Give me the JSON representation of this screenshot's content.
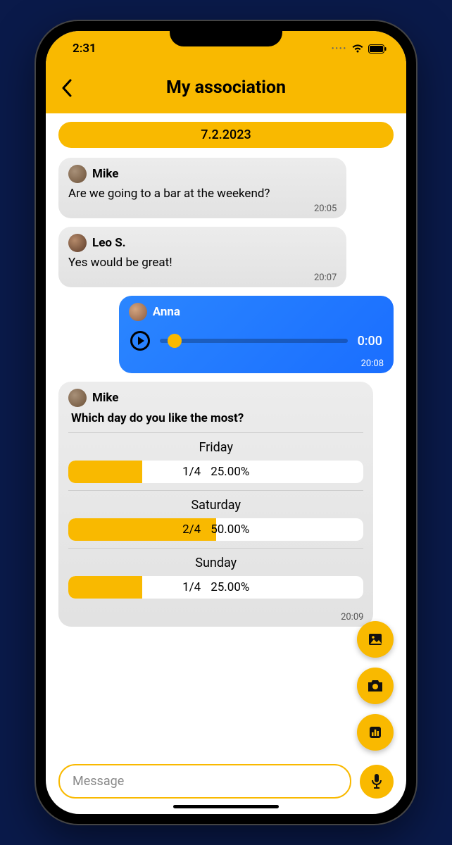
{
  "status": {
    "time": "2:31"
  },
  "header": {
    "title": "My association"
  },
  "date_label": "7.2.2023",
  "messages": {
    "m1": {
      "sender": "Mike",
      "text": "Are we going to a bar at the weekend?",
      "time": "20:05"
    },
    "m2": {
      "sender": "Leo S.",
      "text": "Yes would be great!",
      "time": "20:07"
    },
    "m3": {
      "sender": "Anna",
      "audio_time": "0:00",
      "time": "20:08"
    },
    "m4": {
      "sender": "Mike",
      "question": "Which day do you like the most?",
      "time": "20:09",
      "opts": {
        "o1": {
          "label": "Friday",
          "count": "1/4",
          "pct": "25.00%"
        },
        "o2": {
          "label": "Saturday",
          "count": "2/4",
          "pct": "50.00%"
        },
        "o3": {
          "label": "Sunday",
          "count": "1/4",
          "pct": "25.00%"
        }
      }
    }
  },
  "input": {
    "placeholder": "Message"
  }
}
